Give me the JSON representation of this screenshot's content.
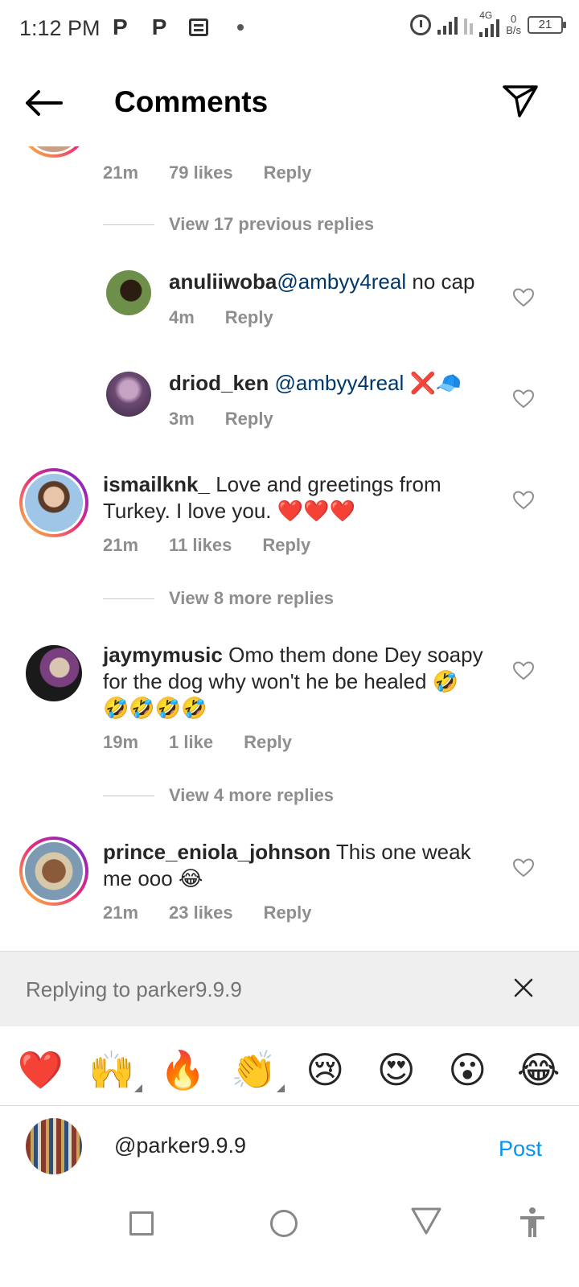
{
  "status_bar": {
    "time": "1:12 PM",
    "network_type": "4G",
    "data_speed_value": "0",
    "data_speed_unit": "B/s",
    "battery": "21",
    "left_icons": [
      "p-app-icon",
      "p-app-icon",
      "news-icon",
      "dot-icon"
    ],
    "right_icons": [
      "alarm-icon",
      "signal-icon",
      "data-transfer-icon",
      "signal-4g-icon",
      "battery-icon"
    ]
  },
  "header": {
    "title": "Comments",
    "back_icon": "arrow-left-icon",
    "share_icon": "send-icon"
  },
  "top_comment_partial": {
    "time": "21m",
    "likes": "79 likes",
    "reply": "Reply"
  },
  "view_previous_replies": "View 17 previous replies",
  "replies": [
    {
      "username": "anuliiwoba",
      "mention": "@ambyy4real",
      "text": " no cap",
      "time": "4m",
      "reply": "Reply"
    },
    {
      "username": "driod_ken",
      "mention": "@ambyy4real",
      "text": " ❌🧢",
      "time": "3m",
      "reply": "Reply"
    }
  ],
  "comments": [
    {
      "username": "ismailknk_",
      "text_line1": " Love and greetings from",
      "text_line2": "Turkey. I love you. ❤️❤️❤️",
      "time": "21m",
      "likes": "11 likes",
      "reply": "Reply",
      "view_replies": "View 8 more replies"
    },
    {
      "username": "jaymymusic",
      "text_line1": " Omo them done Dey soapy",
      "text_line2": "for the dog why won't he be healed 🤣",
      "text_line3": "🤣🤣🤣🤣",
      "time": "19m",
      "likes": "1 like",
      "reply": "Reply",
      "view_replies": "View 4 more replies"
    },
    {
      "username": "prince_eniola_johnson",
      "text_line1": " This one weak",
      "text_line2": "me ooo 😂",
      "time": "21m",
      "likes": "23 likes",
      "reply": "Reply"
    }
  ],
  "replying_bar": {
    "text": "Replying to parker9.9.9",
    "close_icon": "close-icon"
  },
  "emoji_bar": [
    "❤️",
    "🙌",
    "🔥",
    "👏",
    "😢",
    "😍",
    "😮",
    "😂"
  ],
  "composer": {
    "value": "@parker9.9.9",
    "post_label": "Post"
  },
  "nav_bar": {
    "icons": [
      "recents-square-icon",
      "home-circle-icon",
      "back-triangle-icon",
      "accessibility-icon"
    ]
  },
  "colors": {
    "link_blue": "#0095f6",
    "mention_blue": "#00376b",
    "meta_gray": "#8e8e8e",
    "reply_bar_bg": "#efefef"
  }
}
